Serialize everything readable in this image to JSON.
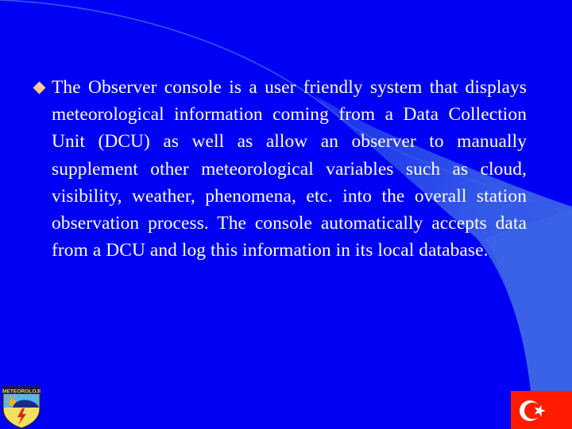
{
  "slide": {
    "background_color": "#0000F5",
    "accent_swoosh_color": "#3A62E8",
    "bullet": {
      "icon": "diamond-bullet-icon",
      "color": "#F9C686",
      "text": "The Observer console is a user friendly system that displays meteorological information coming from a Data Collection Unit (DCU) as well as allow an observer to manually supplement other meteorological variables such as cloud, visibility, weather, phenomena, etc. into the overall station observation process. The console automatically accepts data from a DCU and log this information in its local database."
    },
    "logo": {
      "icon": "meteoroloji-logo-icon",
      "label": "METEOROLOJI"
    },
    "flag": {
      "icon": "turkish-flag-icon",
      "color": "#FF1A00"
    }
  }
}
